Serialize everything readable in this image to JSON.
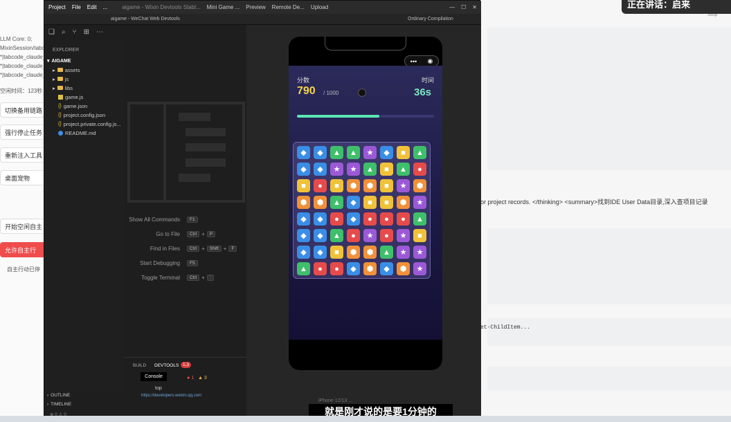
{
  "banner": {
    "speaking": "正在讲话：启来"
  },
  "background_app": {
    "lines": [
      "LLM Core: 0;",
      "MixinSession/tabc",
      "*|tabcode_claude_",
      "*|tabcode_claude_",
      "*|tabcode_claude_",
      "空闲时间：123秒"
    ],
    "buttons": [
      "切换备用链路",
      "强行停止任务",
      "重新注入工具",
      "桌面宠物",
      "开始空闲自主",
      "允许自主行"
    ],
    "status": "自主行动已停",
    "right_text_1": "or project records. </thinking> <summary>找到IDE User Data目录,深入查项目记录",
    "right_text_2": "et-ChildItem...",
    "stop": "Stop"
  },
  "devtools": {
    "menu": [
      "Project",
      "File",
      "Edit",
      "..."
    ],
    "title": "aigame - Wixin Devtools Stabl...",
    "mode": "Mini Game ...",
    "toolbar": [
      "Preview",
      "Remote De...",
      "Upload"
    ],
    "subtitle": "aigame - WeChat Web Devtools",
    "compile": "Ordinary Compilation",
    "explorer": {
      "heading": "EXPLORER",
      "root": "AIGAME",
      "items": [
        {
          "name": "assets",
          "kind": "folder"
        },
        {
          "name": "js",
          "kind": "folder"
        },
        {
          "name": "libs",
          "kind": "folder"
        },
        {
          "name": "game.js",
          "kind": "js"
        },
        {
          "name": "game.json",
          "kind": "json"
        },
        {
          "name": "project.config.json",
          "kind": "json"
        },
        {
          "name": "project.private.config.js...",
          "kind": "json"
        },
        {
          "name": "README.md",
          "kind": "info"
        }
      ],
      "outline": "OUTLINE",
      "timeline": "TIMELINE",
      "status": "⊗ 0 ⚠ 0"
    },
    "shortcuts": [
      {
        "label": "Show All Commands",
        "keys": [
          "F1"
        ]
      },
      {
        "label": "Go to File",
        "keys": [
          "Ctrl",
          "+",
          "P"
        ]
      },
      {
        "label": "Find in Files",
        "keys": [
          "Ctrl",
          "+",
          "Shift",
          "+",
          "F"
        ]
      },
      {
        "label": "Start Debugging",
        "keys": [
          "F5"
        ]
      },
      {
        "label": "Toggle Terminal",
        "keys": [
          "Ctrl",
          "+",
          "`"
        ]
      }
    ],
    "panel": {
      "tabs": [
        "BUILD",
        "DEVTOOLS"
      ],
      "badge": "1,3",
      "console": "Console",
      "errors": "1",
      "warnings": "3",
      "context": "top",
      "link": "https://developers.weixin.qq.com"
    },
    "device": "iPhone 12/13 ..."
  },
  "game": {
    "score_label": "分数",
    "score": "790",
    "score_max": "/ 1000",
    "time_label": "时间",
    "time": "36s",
    "progress": 0.6,
    "grid": [
      [
        "◆b",
        "◆b",
        "▲g",
        "▲g",
        "★p",
        "◆b",
        "■y",
        "▲g"
      ],
      [
        "◆b",
        "◆b",
        "★p",
        "★p",
        "▲g",
        "■y",
        "▲g",
        "●r"
      ],
      [
        "■y",
        "●r",
        "■y",
        "⬢o",
        "⬢o",
        "■y",
        "★p",
        "⬢o"
      ],
      [
        "⬢o",
        "⬢o",
        "▲g",
        "◆b",
        "■y",
        "■y",
        "⬢o",
        "★p"
      ],
      [
        "◆b",
        "◆b",
        "●r",
        "◆b",
        "●r",
        "●r",
        "●r",
        "▲g"
      ],
      [
        "◆b",
        "◆b",
        "▲g",
        "●r",
        "★p",
        "●r",
        "★p",
        "■y"
      ],
      [
        "◆b",
        "◆b",
        "■y",
        "⬢o",
        "⬢o",
        "▲g",
        "★p",
        "★p"
      ],
      [
        "▲g",
        "●r",
        "●r",
        "◆b",
        "⬢o",
        "◆b",
        "⬢o",
        "★p"
      ]
    ]
  },
  "caption": "就是刚才说的是要1分钟的",
  "colors": {
    "b": "#3a8ee6",
    "g": "#3fbf6a",
    "p": "#9b59d6",
    "y": "#f0c23a",
    "r": "#e64b4b",
    "o": "#f0913a"
  }
}
